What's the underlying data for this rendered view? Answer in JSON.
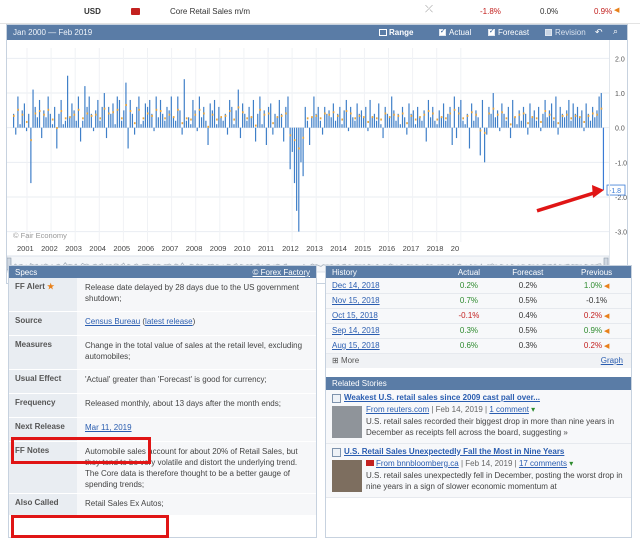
{
  "top": {
    "currency": "USD",
    "event": "Core Retail Sales m/m",
    "actual": "-1.8%",
    "forecast": "0.0%",
    "previous": "0.9%"
  },
  "chart_bar": {
    "range_title": "Jan 2000 — Feb 2019",
    "range_label": "Range",
    "actual_label": "Actual",
    "forecast_label": "Forecast",
    "revision_label": "Revision"
  },
  "chart_data": {
    "type": "bar",
    "x_years": [
      "2001",
      "2002",
      "2003",
      "2004",
      "2005",
      "2006",
      "2007",
      "2008",
      "2009",
      "2010",
      "2011",
      "2012",
      "2013",
      "2014",
      "2015",
      "2016",
      "2017",
      "2018",
      "20"
    ],
    "y_ticks": [
      "2.0",
      "1.0",
      "0.0",
      "-1.0",
      "-2.0",
      "-3.0"
    ],
    "ylim": [
      -3.3,
      2.3
    ],
    "watermark": "© Fair Economy",
    "last_value_label": "-1.8",
    "series_actual_monthly": [
      0.4,
      -0.2,
      0.9,
      0.1,
      0.5,
      0.7,
      -0.1,
      0.4,
      -1.6,
      1.1,
      0.6,
      0.3,
      0.8,
      -0.3,
      0.5,
      0.3,
      0.9,
      0.4,
      0.1,
      0.6,
      -0.6,
      0.4,
      0.8,
      0.1,
      0.2,
      1.5,
      0.3,
      0.7,
      0.5,
      0.2,
      0.9,
      -0.4,
      0.2,
      1.2,
      0.6,
      0.9,
      0.4,
      -0.1,
      0.5,
      0.8,
      0.2,
      0.6,
      1.0,
      -0.3,
      0.6,
      0.4,
      0.7,
      0.1,
      0.9,
      0.8,
      0.2,
      0.5,
      1.3,
      -0.6,
      0.8,
      0.4,
      -0.2,
      0.6,
      0.9,
      0.1,
      0.2,
      0.7,
      0.6,
      0.8,
      0.4,
      -0.1,
      0.9,
      0.3,
      0.8,
      0.4,
      0.2,
      0.6,
      0.5,
      0.9,
      0.3,
      0.2,
      0.9,
      0.5,
      -0.2,
      1.4,
      0.2,
      0.3,
      0.1,
      0.8,
      0.5,
      -0.1,
      0.9,
      0.3,
      0.6,
      0.2,
      -0.5,
      0.7,
      0.5,
      0.8,
      0.1,
      0.6,
      0.3,
      0.2,
      0.4,
      -0.2,
      0.8,
      0.6,
      0.1,
      0.5,
      1.1,
      -0.3,
      0.7,
      0.4,
      0.2,
      0.6,
      0.3,
      0.8,
      -0.4,
      0.4,
      0.9,
      0.1,
      0.5,
      -0.5,
      0.6,
      0.7,
      -0.2,
      0.4,
      0.3,
      0.8,
      0.4,
      -0.4,
      0.6,
      0.9,
      -1.2,
      -0.7,
      -1.6,
      -2.4,
      -3.0,
      -1.0,
      -1.4,
      0.6,
      0.2,
      -0.5,
      0.3,
      0.9,
      0.4,
      0.6,
      0.2,
      -0.2,
      0.6,
      0.4,
      0.5,
      0.3,
      0.7,
      0.2,
      0.4,
      0.6,
      0.1,
      0.5,
      0.8,
      -0.1,
      0.6,
      0.3,
      0.2,
      0.7,
      0.4,
      0.5,
      0.3,
      0.6,
      -0.1,
      0.8,
      0.3,
      0.4,
      0.2,
      0.7,
      0.1,
      -0.3,
      0.6,
      0.4,
      0.3,
      0.9,
      0.5,
      0.2,
      0.4,
      0.1,
      0.6,
      0.3,
      -0.2,
      0.7,
      0.4,
      0.5,
      0.1,
      0.6,
      0.3,
      0.2,
      0.5,
      -0.4,
      0.8,
      0.3,
      0.6,
      0.2,
      0.1,
      0.5,
      0.3,
      0.7,
      0.2,
      0.4,
      0.6,
      -0.5,
      0.9,
      -0.3,
      0.6,
      0.8,
      0.2,
      0.1,
      0.4,
      -0.6,
      0.7,
      0.2,
      0.5,
      0.3,
      -0.8,
      0.8,
      -1.0,
      -0.2,
      0.6,
      0.4,
      1.0,
      0.3,
      0.5,
      -0.1,
      0.7,
      0.4,
      0.2,
      0.6,
      -0.3,
      0.8,
      0.3,
      0.1,
      0.5,
      0.2,
      0.6,
      0.4,
      -0.2,
      0.7,
      0.3,
      0.5,
      0.2,
      0.6,
      -0.1,
      0.4,
      0.8,
      0.3,
      0.5,
      0.7,
      0.2,
      0.9,
      -0.2,
      0.6,
      0.4,
      0.3,
      0.5,
      0.8,
      0.2,
      0.7,
      0.4,
      0.6,
      0.3,
      0.5,
      -0.1,
      0.7,
      0.4,
      0.2,
      0.6,
      0.3,
      0.5,
      0.9,
      1.0,
      -1.8
    ]
  },
  "specs": {
    "title": "Specs",
    "source_link": "© Forex Factory",
    "rows": [
      {
        "key": "FF Alert",
        "value": "Release date delayed by 28 days due to the US government shutdown;"
      },
      {
        "key": "Source",
        "value": "Census Bureau",
        "extra": "latest release"
      },
      {
        "key": "Measures",
        "value": "Change in the total value of sales at the retail level, excluding automobiles;"
      },
      {
        "key": "Usual Effect",
        "value": "'Actual' greater than 'Forecast' is good for currency;"
      },
      {
        "key": "Frequency",
        "value": "Released monthly, about 13 days after the month ends;"
      },
      {
        "key": "Next Release",
        "value": "Mar 11, 2019"
      },
      {
        "key": "FF Notes",
        "value": "Automobile sales account for about 20% of Retail Sales, but they tend to be very volatile and distort the underlying trend. The Core data is therefore thought to be a better gauge of spending trends;"
      },
      {
        "key": "Also Called",
        "value": "Retail Sales Ex Autos;"
      }
    ]
  },
  "history": {
    "headers": [
      "History",
      "Actual",
      "Forecast",
      "Previous"
    ],
    "rows": [
      {
        "date": "Dec 14, 2018",
        "actual": "0.2%",
        "forecast": "0.2%",
        "previous": "1.0%"
      },
      {
        "date": "Nov 15, 2018",
        "actual": "0.7%",
        "forecast": "0.5%",
        "previous": "-0.1%"
      },
      {
        "date": "Oct 15, 2018",
        "actual": "-0.1%",
        "forecast": "0.4%",
        "previous": "0.2%"
      },
      {
        "date": "Sep 14, 2018",
        "actual": "0.3%",
        "forecast": "0.5%",
        "previous": "0.9%"
      },
      {
        "date": "Aug 15, 2018",
        "actual": "0.6%",
        "forecast": "0.3%",
        "previous": "0.2%"
      }
    ],
    "more": "More",
    "graph": "Graph"
  },
  "related": {
    "title": "Related Stories",
    "stories": [
      {
        "title": "Weakest U.S. retail sales since 2009 cast pall over...",
        "source": "From reuters.com",
        "date": "Feb 14, 2019",
        "comments": "1 comment",
        "body": "U.S. retail sales recorded their biggest drop in more than nine years in December as receipts fell across the board, suggesting »"
      },
      {
        "title": "U.S. Retail Sales Unexpectedly Fall the Most in Nine Years",
        "source": "From bnnbloomberg.ca",
        "date": "Feb 14, 2019",
        "comments": "17 comments",
        "body": "U.S. retail sales unexpectedly fell in December, posting the worst drop in nine years in a sign of slower economic momentum at"
      }
    ]
  }
}
